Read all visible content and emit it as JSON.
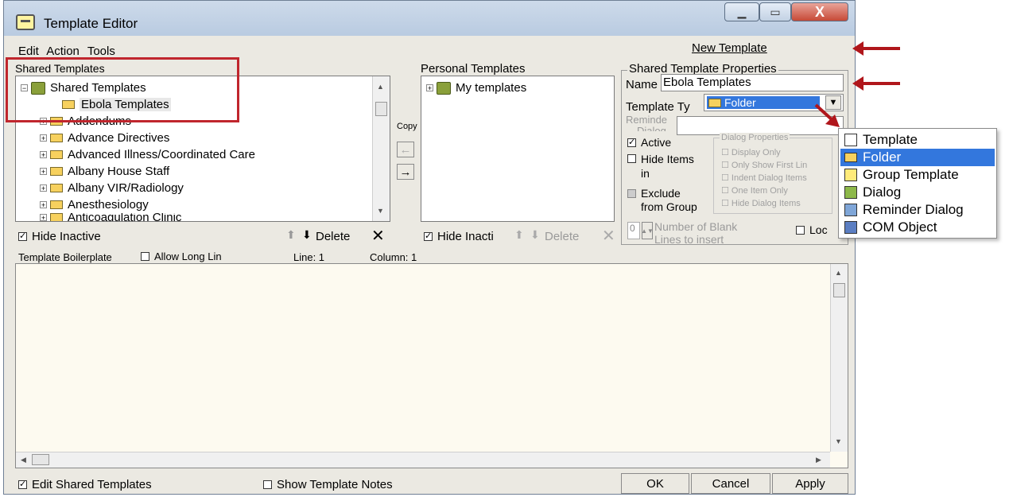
{
  "window": {
    "title": "Template Editor"
  },
  "menu": [
    "Edit",
    "Action",
    "Tools"
  ],
  "new_template": "New Template",
  "shared": {
    "header": "Shared Templates",
    "tree": [
      {
        "label": "Shared Templates"
      },
      {
        "label": "Ebola Templates"
      },
      {
        "label": "Addendums"
      },
      {
        "label": "Advance Directives"
      },
      {
        "label": "Advanced Illness/Coordinated Care"
      },
      {
        "label": "Albany House Staff"
      },
      {
        "label": "Albany VIR/Radiology"
      },
      {
        "label": "Anesthesiology"
      },
      {
        "label": "Anticoagulation Clinic"
      }
    ],
    "hide_inactive": "Hide Inactive",
    "delete": "Delete"
  },
  "copy_label": "Copy",
  "personal": {
    "header": "Personal Templates",
    "tree": [
      {
        "label": "My templates"
      }
    ],
    "hide_inactive": "Hide Inacti",
    "delete": "Delete"
  },
  "properties": {
    "header": "Shared Template Properties",
    "name_label": "Name",
    "name_value": "Ebola Templates",
    "type_label": "Template Ty",
    "type_value": "Folder",
    "reminder_label": "Reminde",
    "dialog_label": "Dialog",
    "active_label": "Active",
    "hide_items_label": "Hide Items in Template",
    "exclude_label": "Exclude from Group",
    "number_blank_label": "Number of Blank Lines to insert",
    "blank_value": "0",
    "lock_label": "Loc",
    "dialog_props": {
      "header": "Dialog Properties",
      "items": [
        "Display Only",
        "Only Show First Lin",
        "Indent Dialog Items",
        "One Item Only",
        "Hide Dialog Items"
      ]
    }
  },
  "type_options": [
    "Template",
    "Folder",
    "Group Template",
    "Dialog",
    "Reminder Dialog",
    "COM Object"
  ],
  "boilerplate": {
    "label": "Template Boilerplate",
    "allow_long": "Allow Long Lin",
    "line": "Line: 1",
    "column": "Column: 1"
  },
  "footer": {
    "edit_shared": "Edit Shared Templates",
    "show_notes": "Show Template Notes",
    "ok": "OK",
    "cancel": "Cancel",
    "apply": "Apply"
  },
  "colors": {
    "annotation_red": "#b0161b",
    "selection_blue": "#3377dd",
    "boilerplate_bg": "#fdfaf0"
  }
}
